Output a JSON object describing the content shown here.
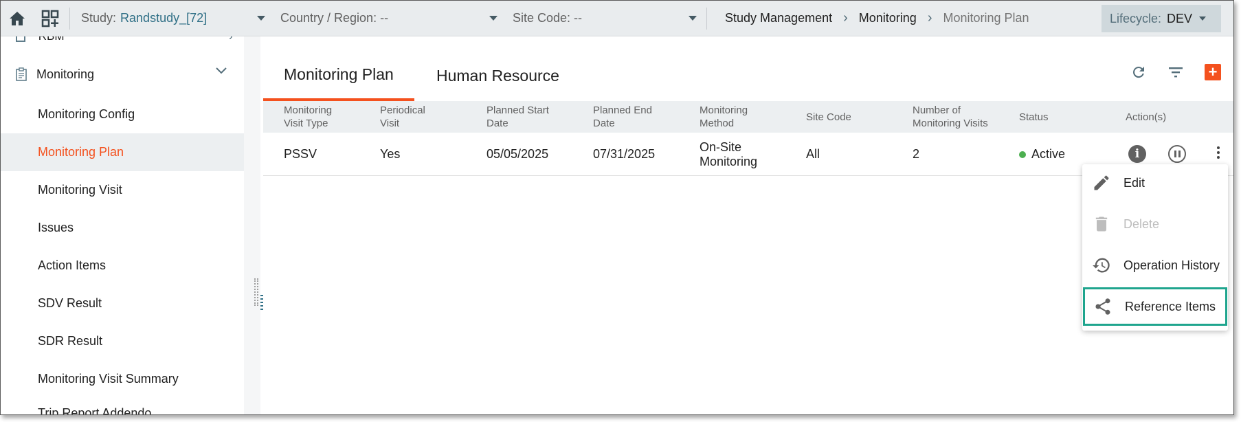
{
  "topbar": {
    "study_label": "Study:",
    "study_value": "Randstudy_[72]",
    "country_label": "Country / Region: --",
    "site_label": "Site Code: --",
    "breadcrumb": [
      "Study Management",
      "Monitoring",
      "Monitoring Plan"
    ],
    "lifecycle_label": "Lifecycle:",
    "lifecycle_value": "DEV"
  },
  "sidebar": {
    "partial_top": "RBM",
    "section_label": "Monitoring",
    "items": [
      {
        "label": "Monitoring Config"
      },
      {
        "label": "Monitoring Plan"
      },
      {
        "label": "Monitoring Visit"
      },
      {
        "label": "Issues"
      },
      {
        "label": "Action Items"
      },
      {
        "label": "SDV Result"
      },
      {
        "label": "SDR Result"
      },
      {
        "label": "Monitoring Visit Summary"
      }
    ],
    "partial_bottom": "Trip Report Addendo"
  },
  "tabs": [
    {
      "label": "Monitoring Plan"
    },
    {
      "label": "Human Resource"
    }
  ],
  "table": {
    "headers": [
      [
        "Monitoring",
        "Visit Type"
      ],
      [
        "Periodical",
        "Visit"
      ],
      [
        "Planned Start",
        "Date"
      ],
      [
        "Planned End",
        "Date"
      ],
      [
        "Monitoring",
        "Method"
      ],
      [
        "Site Code",
        ""
      ],
      [
        "Number of",
        "Monitoring Visits"
      ],
      [
        "Status",
        ""
      ],
      [
        "Action(s)",
        ""
      ]
    ],
    "row": {
      "visit_type": "PSSV",
      "periodical": "Yes",
      "start": "05/05/2025",
      "end": "07/31/2025",
      "method_line1": "On-Site",
      "method_line2": "Monitoring",
      "site_code": "All",
      "visits": "2",
      "status": "Active"
    }
  },
  "menu": {
    "edit": "Edit",
    "delete": "Delete",
    "history": "Operation History",
    "reference": "Reference Items"
  },
  "colors": {
    "accent": "#f4511e",
    "status_active": "#4caf50",
    "highlight": "#1fa58e"
  }
}
